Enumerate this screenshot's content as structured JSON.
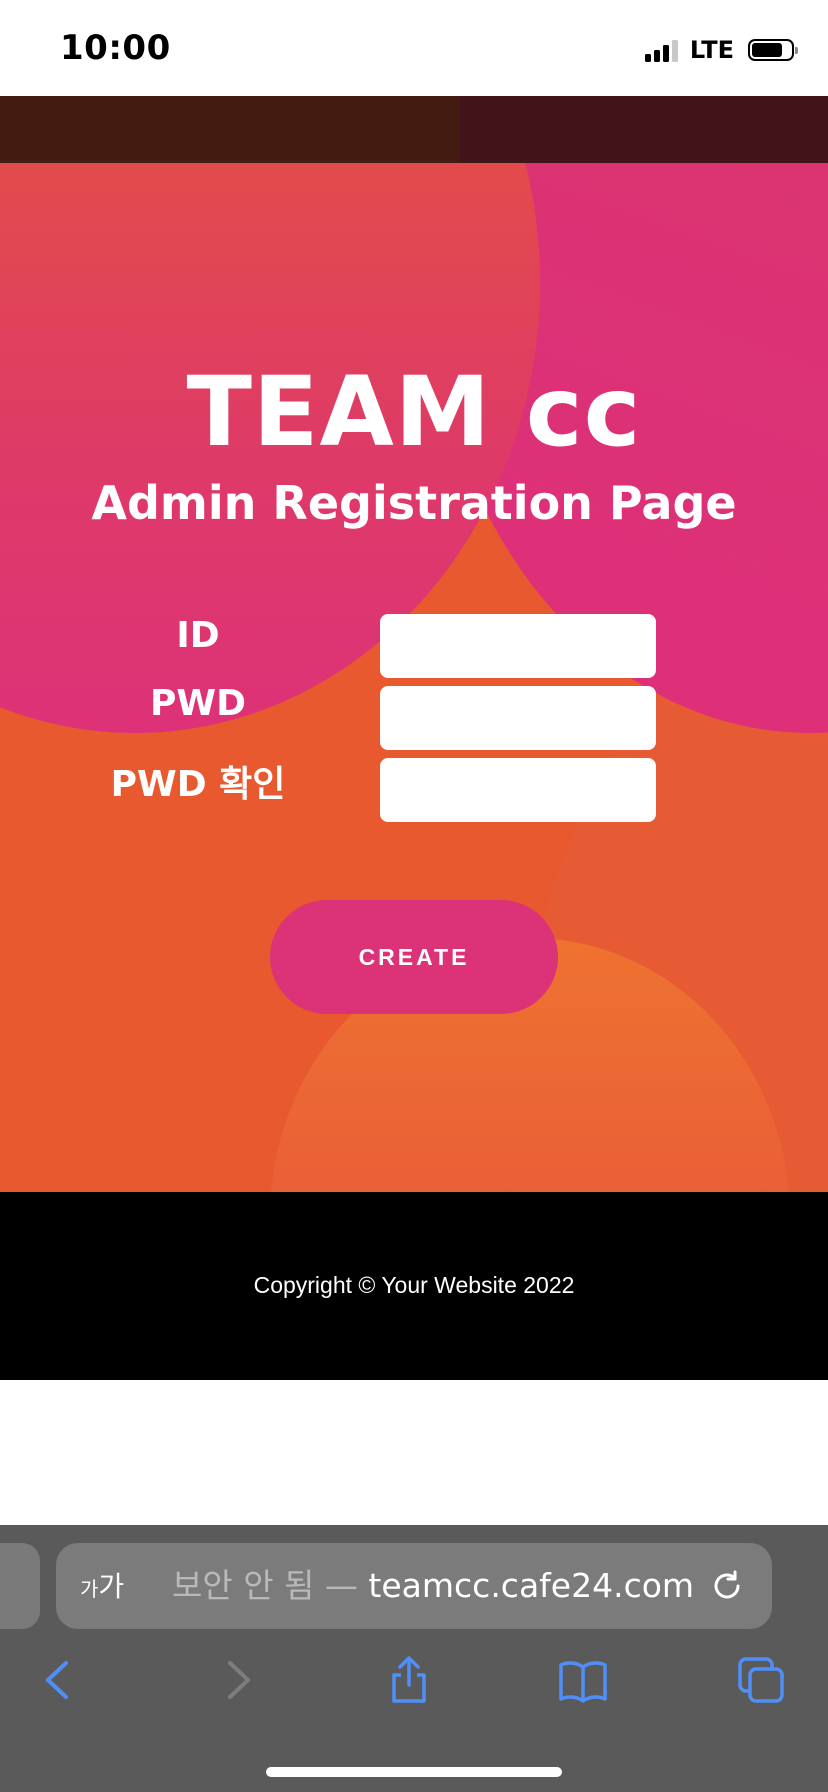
{
  "status_bar": {
    "time": "10:00",
    "network": "LTE"
  },
  "hero": {
    "title": "TEAM cc",
    "subtitle": "Admin Registration Page"
  },
  "form": {
    "id_label": "ID",
    "pwd_label": "PWD",
    "pwd_confirm_label": "PWD 확인",
    "id_value": "",
    "pwd_value": "",
    "pwd_confirm_value": "",
    "create_label": "CREATE"
  },
  "footer": {
    "copyright": "Copyright © Your Website 2022"
  },
  "browser": {
    "text_size_label_small": "가",
    "text_size_label_large": "가",
    "security_label": "보안 안 됨 —",
    "domain": "teamcc.cafe24.com",
    "icons": {
      "reload": "reload-icon",
      "back": "chevron-left-icon",
      "forward": "chevron-right-icon",
      "share": "share-icon",
      "bookmarks": "book-icon",
      "tabs": "tabs-icon"
    }
  },
  "colors": {
    "accent_pink": "#dc3378",
    "hero_orange": "#e8592f",
    "browser_link_blue": "#4f8ff7"
  }
}
